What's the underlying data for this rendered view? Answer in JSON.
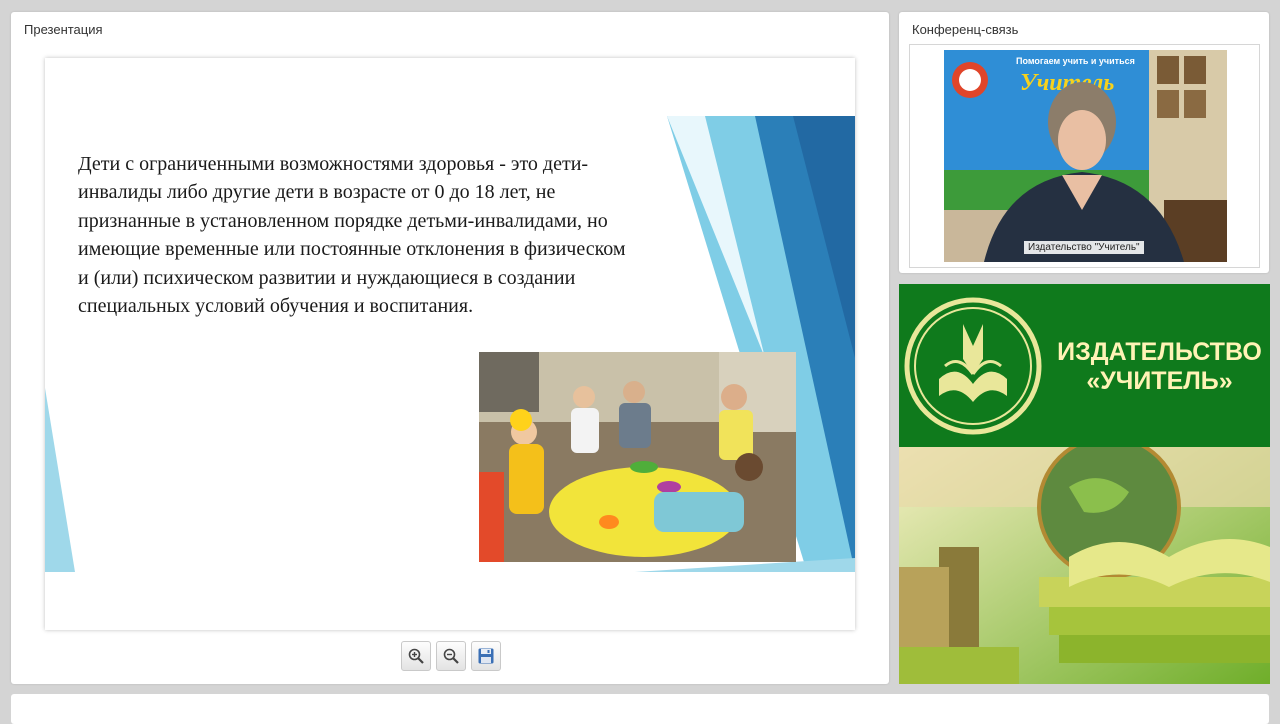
{
  "presentation": {
    "title": "Презентация",
    "slide": {
      "text": "Дети с ограниченными возможностями здоровья  - это дети-инвалиды либо другие дети в возрасте от 0 до 18 лет, не признанные в установленном порядке детьми-инвалидами,  но имеющие временные или постоянные отклонения в физическом и (или) психическом развитии и нуждающиеся в создании специальных условий обучения и воспитания."
    },
    "toolbar": {
      "zoom_in_icon": "zoom-in-icon",
      "zoom_out_icon": "zoom-out-icon",
      "save_icon": "floppy-disk-icon"
    }
  },
  "conference": {
    "title": "Конференц-связь",
    "video": {
      "banner_slogan": "Помогаем учить и учиться",
      "banner_brand": "Учитель",
      "caption": "Издательство \"Учитель\""
    }
  },
  "brand": {
    "name_line1": "ИЗДАТЕЛЬСТВО",
    "name_line2": "«УЧИТЕЛЬ»",
    "colors": {
      "green": "#0f7a1c",
      "text": "#fff3b6"
    }
  }
}
